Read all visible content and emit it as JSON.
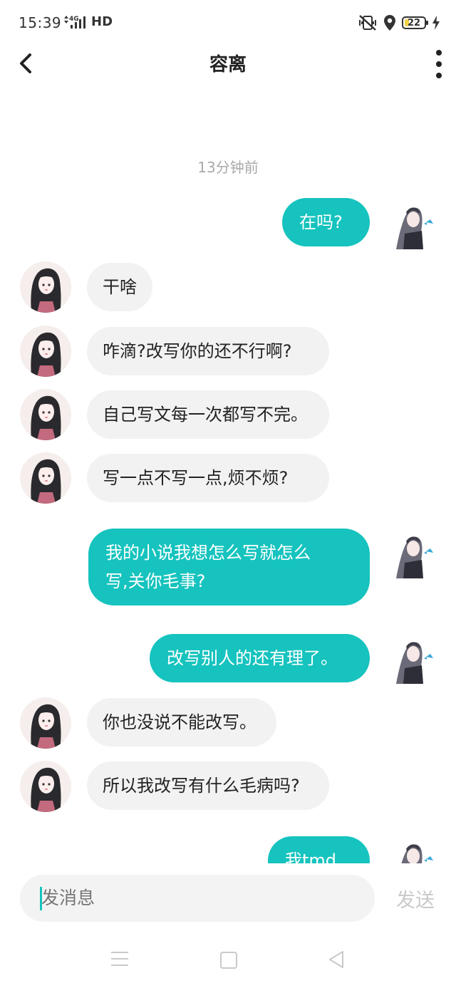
{
  "status_bar": {
    "time": "15:39",
    "network": "4G",
    "hd": "HD",
    "battery": "22"
  },
  "header": {
    "title": "容离"
  },
  "chat": {
    "timestamp": "13分钟前",
    "messages": [
      {
        "direction": "out",
        "text": "在吗?"
      },
      {
        "direction": "in",
        "text": "干啥"
      },
      {
        "direction": "in",
        "text": "咋滴?改写你的还不行啊?"
      },
      {
        "direction": "in",
        "text": "自己写文每一次都写不完。"
      },
      {
        "direction": "in",
        "text": "写一点不写一点,烦不烦?"
      },
      {
        "direction": "out",
        "text": "我的小说我想怎么写就怎么\n写,关你毛事?"
      },
      {
        "direction": "out",
        "text": "改写别人的还有理了。"
      },
      {
        "direction": "in",
        "text": "你也没说不能改写。"
      },
      {
        "direction": "in",
        "text": "所以我改写有什么毛病吗?"
      },
      {
        "direction": "out",
        "text": "我tmd"
      }
    ]
  },
  "input": {
    "placeholder": "发消息"
  },
  "send_label": "发送",
  "colors": {
    "accent": "#16c3be",
    "incoming_bubble": "#f2f2f2"
  }
}
